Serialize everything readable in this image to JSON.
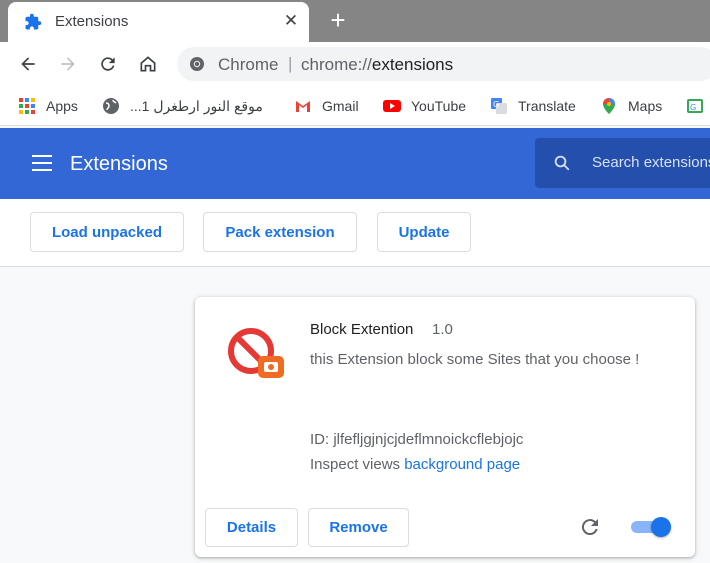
{
  "tab": {
    "title": "Extensions",
    "icon": "puzzle-icon",
    "close": "✕"
  },
  "newtab": "+",
  "omnibox": {
    "scheme_label": "Chrome",
    "separator": "|",
    "url_scheme": "chrome://",
    "url_host": "extensions"
  },
  "bookmarks": [
    {
      "label": "Apps",
      "icon": "apps-grid-icon"
    },
    {
      "label": "موقع النور ارطغرل 1...",
      "icon": "globe-icon"
    },
    {
      "label": "Gmail",
      "icon": "gmail-icon"
    },
    {
      "label": "YouTube",
      "icon": "youtube-icon"
    },
    {
      "label": "Translate",
      "icon": "translate-icon"
    },
    {
      "label": "Maps",
      "icon": "maps-icon"
    }
  ],
  "header": {
    "title": "Extensions",
    "search_placeholder": "Search extensions"
  },
  "devbar": {
    "load_unpacked": "Load unpacked",
    "pack_extension": "Pack extension",
    "update": "Update"
  },
  "extension": {
    "name": "Block Extention",
    "version": "1.0",
    "description": "this Extension block some Sites that you choose !",
    "id_line": "ID: jlfefljgjnjcjdeflmnoickcflebjojc",
    "inspect_label": "Inspect views",
    "inspect_link": "background page",
    "details": "Details",
    "remove": "Remove",
    "enabled": true
  },
  "colors": {
    "accent": "#1a73e8",
    "header_bg": "#3367d6",
    "search_bg": "#254fac"
  }
}
